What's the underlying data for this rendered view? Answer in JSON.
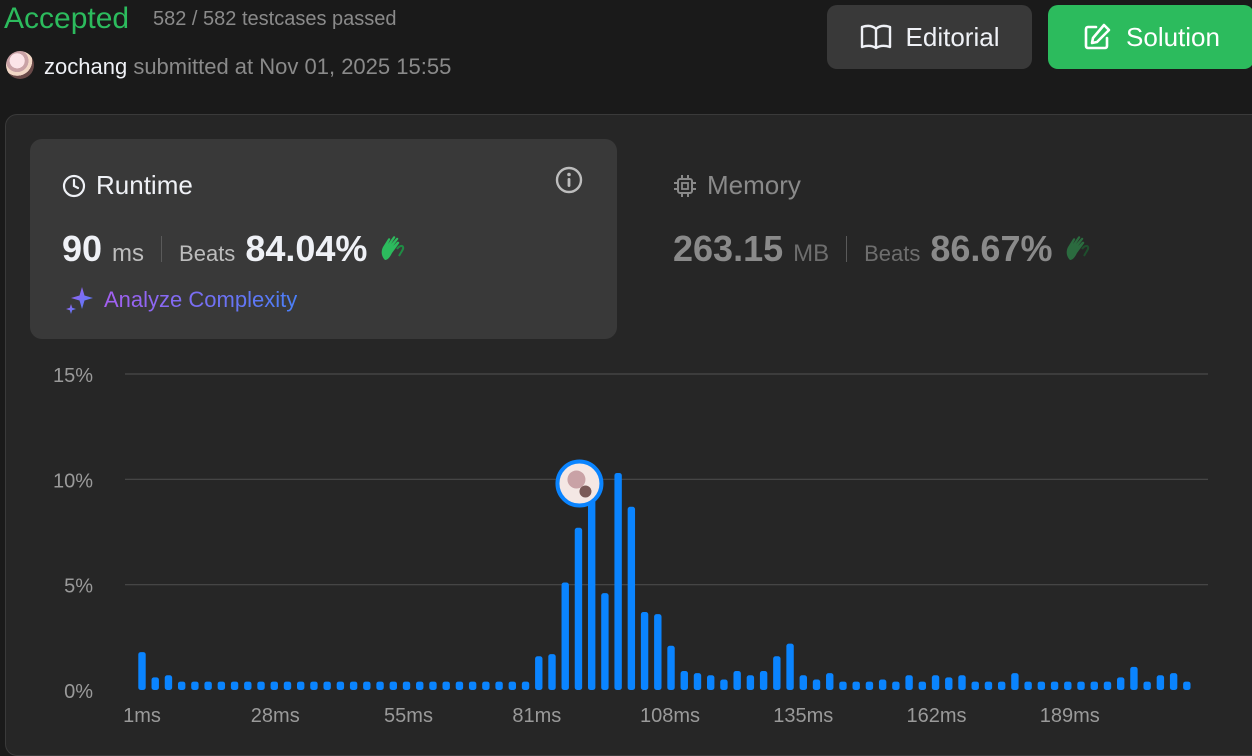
{
  "header": {
    "status": "Accepted",
    "testcases": "582 / 582 testcases passed",
    "username": "zochang",
    "submitted_text": "submitted at Nov 01, 2025 15:55"
  },
  "buttons": {
    "editorial": "Editorial",
    "solution": "Solution"
  },
  "runtime": {
    "title": "Runtime",
    "value": "90",
    "unit": "ms",
    "beats_label": "Beats",
    "beats_pct": "84.04%",
    "analyze": "Analyze Complexity"
  },
  "memory": {
    "title": "Memory",
    "value": "263.15",
    "unit": "MB",
    "beats_label": "Beats",
    "beats_pct": "86.67%"
  },
  "colors": {
    "accepted": "#2cbb5d",
    "bar": "#0a84ff",
    "clap": "#2cbb5d"
  },
  "chart_data": {
    "type": "bar",
    "xlabel": "",
    "ylabel": "",
    "ylim": [
      0,
      15
    ],
    "y_ticks": [
      "0%",
      "5%",
      "10%",
      "15%"
    ],
    "x_tick_labels": [
      "1ms",
      "28ms",
      "55ms",
      "81ms",
      "108ms",
      "135ms",
      "162ms",
      "189ms"
    ],
    "x_tick_values": [
      1,
      28,
      55,
      81,
      108,
      135,
      162,
      189
    ],
    "x_min": 1,
    "x_step": 2.68,
    "values": [
      1.8,
      0.6,
      0.7,
      0.4,
      0.4,
      0.4,
      0.4,
      0.4,
      0.4,
      0.4,
      0.4,
      0.4,
      0.4,
      0.4,
      0.4,
      0.4,
      0.4,
      0.4,
      0.4,
      0.4,
      0.4,
      0.4,
      0.4,
      0.4,
      0.4,
      0.4,
      0.4,
      0.4,
      0.4,
      0.4,
      1.6,
      1.7,
      5.1,
      7.7,
      9.5,
      4.6,
      10.3,
      8.7,
      3.7,
      3.6,
      2.1,
      0.9,
      0.8,
      0.7,
      0.5,
      0.9,
      0.7,
      0.9,
      1.6,
      2.2,
      0.7,
      0.5,
      0.8,
      0.4,
      0.4,
      0.4,
      0.5,
      0.4,
      0.7,
      0.4,
      0.7,
      0.6,
      0.7,
      0.4,
      0.4,
      0.4,
      0.8,
      0.4,
      0.4,
      0.4,
      0.4,
      0.4,
      0.4,
      0.4,
      0.6,
      1.1,
      0.4,
      0.7,
      0.8,
      0.4
    ],
    "marker_index": 33,
    "marker_value": 9.8,
    "grid": true
  }
}
